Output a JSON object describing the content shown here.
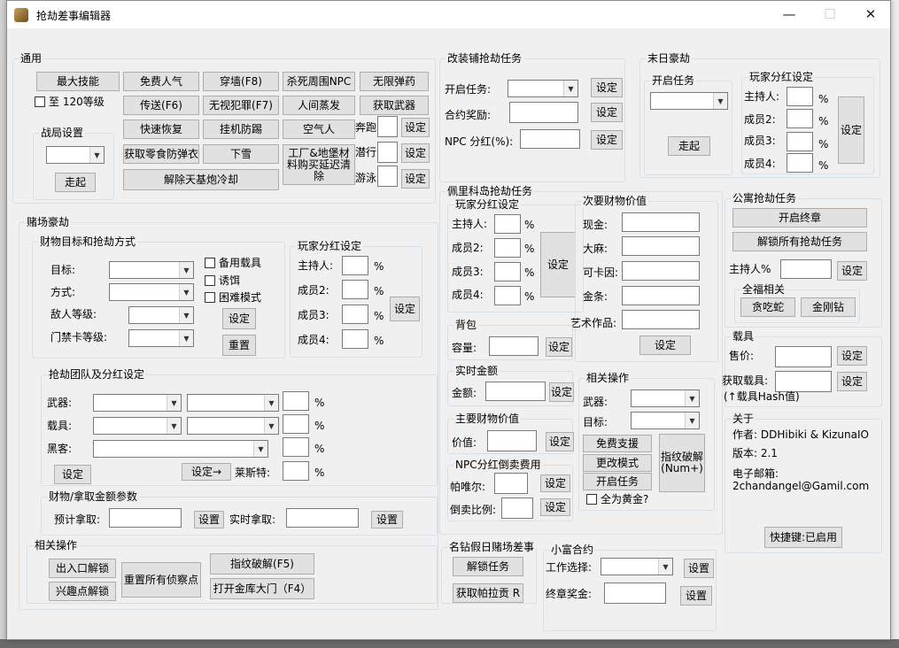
{
  "window": {
    "title": "抢劫差事编辑器",
    "minimize": "—",
    "maximize": "☐",
    "close": "✕"
  },
  "general": {
    "title": "通用",
    "max_skill": "最大技能",
    "to_level_120": "至 120等级",
    "free_snack": "免费人气",
    "teleport": "传送(F6)",
    "quick_recover": "快速恢复",
    "get_snack_armor": "获取零食防弹衣",
    "wall_walk": "穿墙(F8)",
    "ignore_crime": "无视犯罪(F7)",
    "afk_guard": "挂机防踢",
    "snow": "下雪",
    "kill_npc": "杀死周围NPC",
    "hell_bomb": "人间蒸发",
    "air": "空气人",
    "factory_bunker": "工厂&地堡材料购买延迟清除",
    "infinite_ammo": "无限弹药",
    "get_weapon": "获取武器",
    "run": "奔跑",
    "set1": "设定",
    "dive": "潜行",
    "set2": "设定",
    "swim": "游泳",
    "set3": "设定",
    "battle_settings": "战局设置",
    "leave": "走起",
    "remove_orbital_cooldown": "解除天基炮冷却"
  },
  "modify": {
    "title": "改装铺抢劫任务",
    "start_task": "开启任务:",
    "set_start": "设定",
    "contract_reward": "合约奖励:",
    "set_reward": "设定",
    "npc_share": "NPC 分红(%):",
    "set_npc": "设定"
  },
  "doomsday": {
    "title": "末日豪劫",
    "start_task_group": "开启任务",
    "go": "走起",
    "share_title": "玩家分红设定",
    "host": "主持人:",
    "m2": "成员2:",
    "m3": "成员3:",
    "m4": "成员4:",
    "pct": "%",
    "set": "设定"
  },
  "casino": {
    "title": "赌场豪劫",
    "target_mode": {
      "title": "财物目标和抢劫方式",
      "target": "目标:",
      "mode": "方式:",
      "enemy_level": "敌人等级:",
      "keycard": "门禁卡等级:",
      "backup_vehicle": "备用载具",
      "decoy": "诱饵",
      "hard_mode": "困难模式",
      "set": "设定",
      "reset": "重置"
    },
    "share": {
      "title": "玩家分红设定",
      "host": "主持人:",
      "m2": "成员2:",
      "m3": "成员3:",
      "m4": "成员4:",
      "pct": "%",
      "set": "设定"
    },
    "team": {
      "title": "抢劫团队及分红设定",
      "weapon": "武器:",
      "vehicle": "载具:",
      "hacker": "黑客:",
      "pct": "%",
      "set": "设定",
      "set_arrow": "设定→",
      "lester": "莱斯特:"
    },
    "take": {
      "title": "财物/拿取金额参数",
      "expected": "预计拿取:",
      "set1": "设置",
      "actual": "实时拿取:",
      "set2": "设置"
    },
    "ops": {
      "title": "相关操作",
      "door_unlock": "出入口解锁",
      "reset_scouts": "重置所有侦察点",
      "poi_unlock": "兴趣点解锁",
      "fingerprint": "指纹破解(F5)",
      "vault_door": "打开金库大门（F4）"
    }
  },
  "cayo": {
    "title": "佩里科岛抢劫任务",
    "share": {
      "title": "玩家分红设定",
      "host": "主持人:",
      "m2": "成员2:",
      "m3": "成员3:",
      "m4": "成员4:",
      "pct": "%",
      "set": "设定"
    },
    "secondary": {
      "title": "次要财物价值",
      "cash": "现金:",
      "weed": "大麻:",
      "coke": "可卡因:",
      "gold": "金条:",
      "art": "艺术作品:",
      "set": "设定"
    },
    "bag": {
      "title": "背包",
      "capacity": "容量:",
      "set": "设定"
    },
    "realtime": {
      "title": "实时金额",
      "amount": "金额:",
      "set": "设定"
    },
    "primary": {
      "title": "主要财物价值",
      "value": "价值:",
      "set": "设定"
    },
    "npc": {
      "title": "NPC分红倒卖费用",
      "pavel": "帕唯尔:",
      "set1": "设定",
      "fence": "倒卖比例:",
      "set2": "设定"
    },
    "ops": {
      "title": "相关操作",
      "weapon": "武器:",
      "target": "目标:",
      "free_support": "免费支援",
      "change_mode": "更改模式",
      "start_task": "开启任务",
      "all_gold": "全为黄金?",
      "fingerprint": "指纹破解(Num+)"
    }
  },
  "celebrity": {
    "title": "名钻假日赌场差事",
    "unlock": "解锁任务",
    "get_patrick": "获取帕拉贡 R"
  },
  "short": {
    "title": "小富合约",
    "work_choice": "工作选择:",
    "set1": "设置",
    "final_bonus": "终章奖金:",
    "set2": "设置"
  },
  "apartment": {
    "title": "公寓抢劫任务",
    "start_finale": "开启终章",
    "unlock_all": "解锁所有抢劫任务",
    "host_pct": "主持人%",
    "set": "设定",
    "fleeca": {
      "title": "全福相关",
      "greedy_snake": "贪吃蛇",
      "vajra": "金刚钻"
    }
  },
  "vehicle": {
    "title": "载具",
    "price": "售价:",
    "set1": "设定",
    "get_vehicle": "获取载具:",
    "set2": "设定",
    "hash": "(↑载具Hash值)"
  },
  "about": {
    "title": "关于",
    "author": "作者: DDHibiki & KizunaIO",
    "version": "版本: 2.1",
    "email_label": "电子邮箱:",
    "email": "2chandangel@Gamil.com",
    "hotkey": "快捷键:已启用"
  }
}
